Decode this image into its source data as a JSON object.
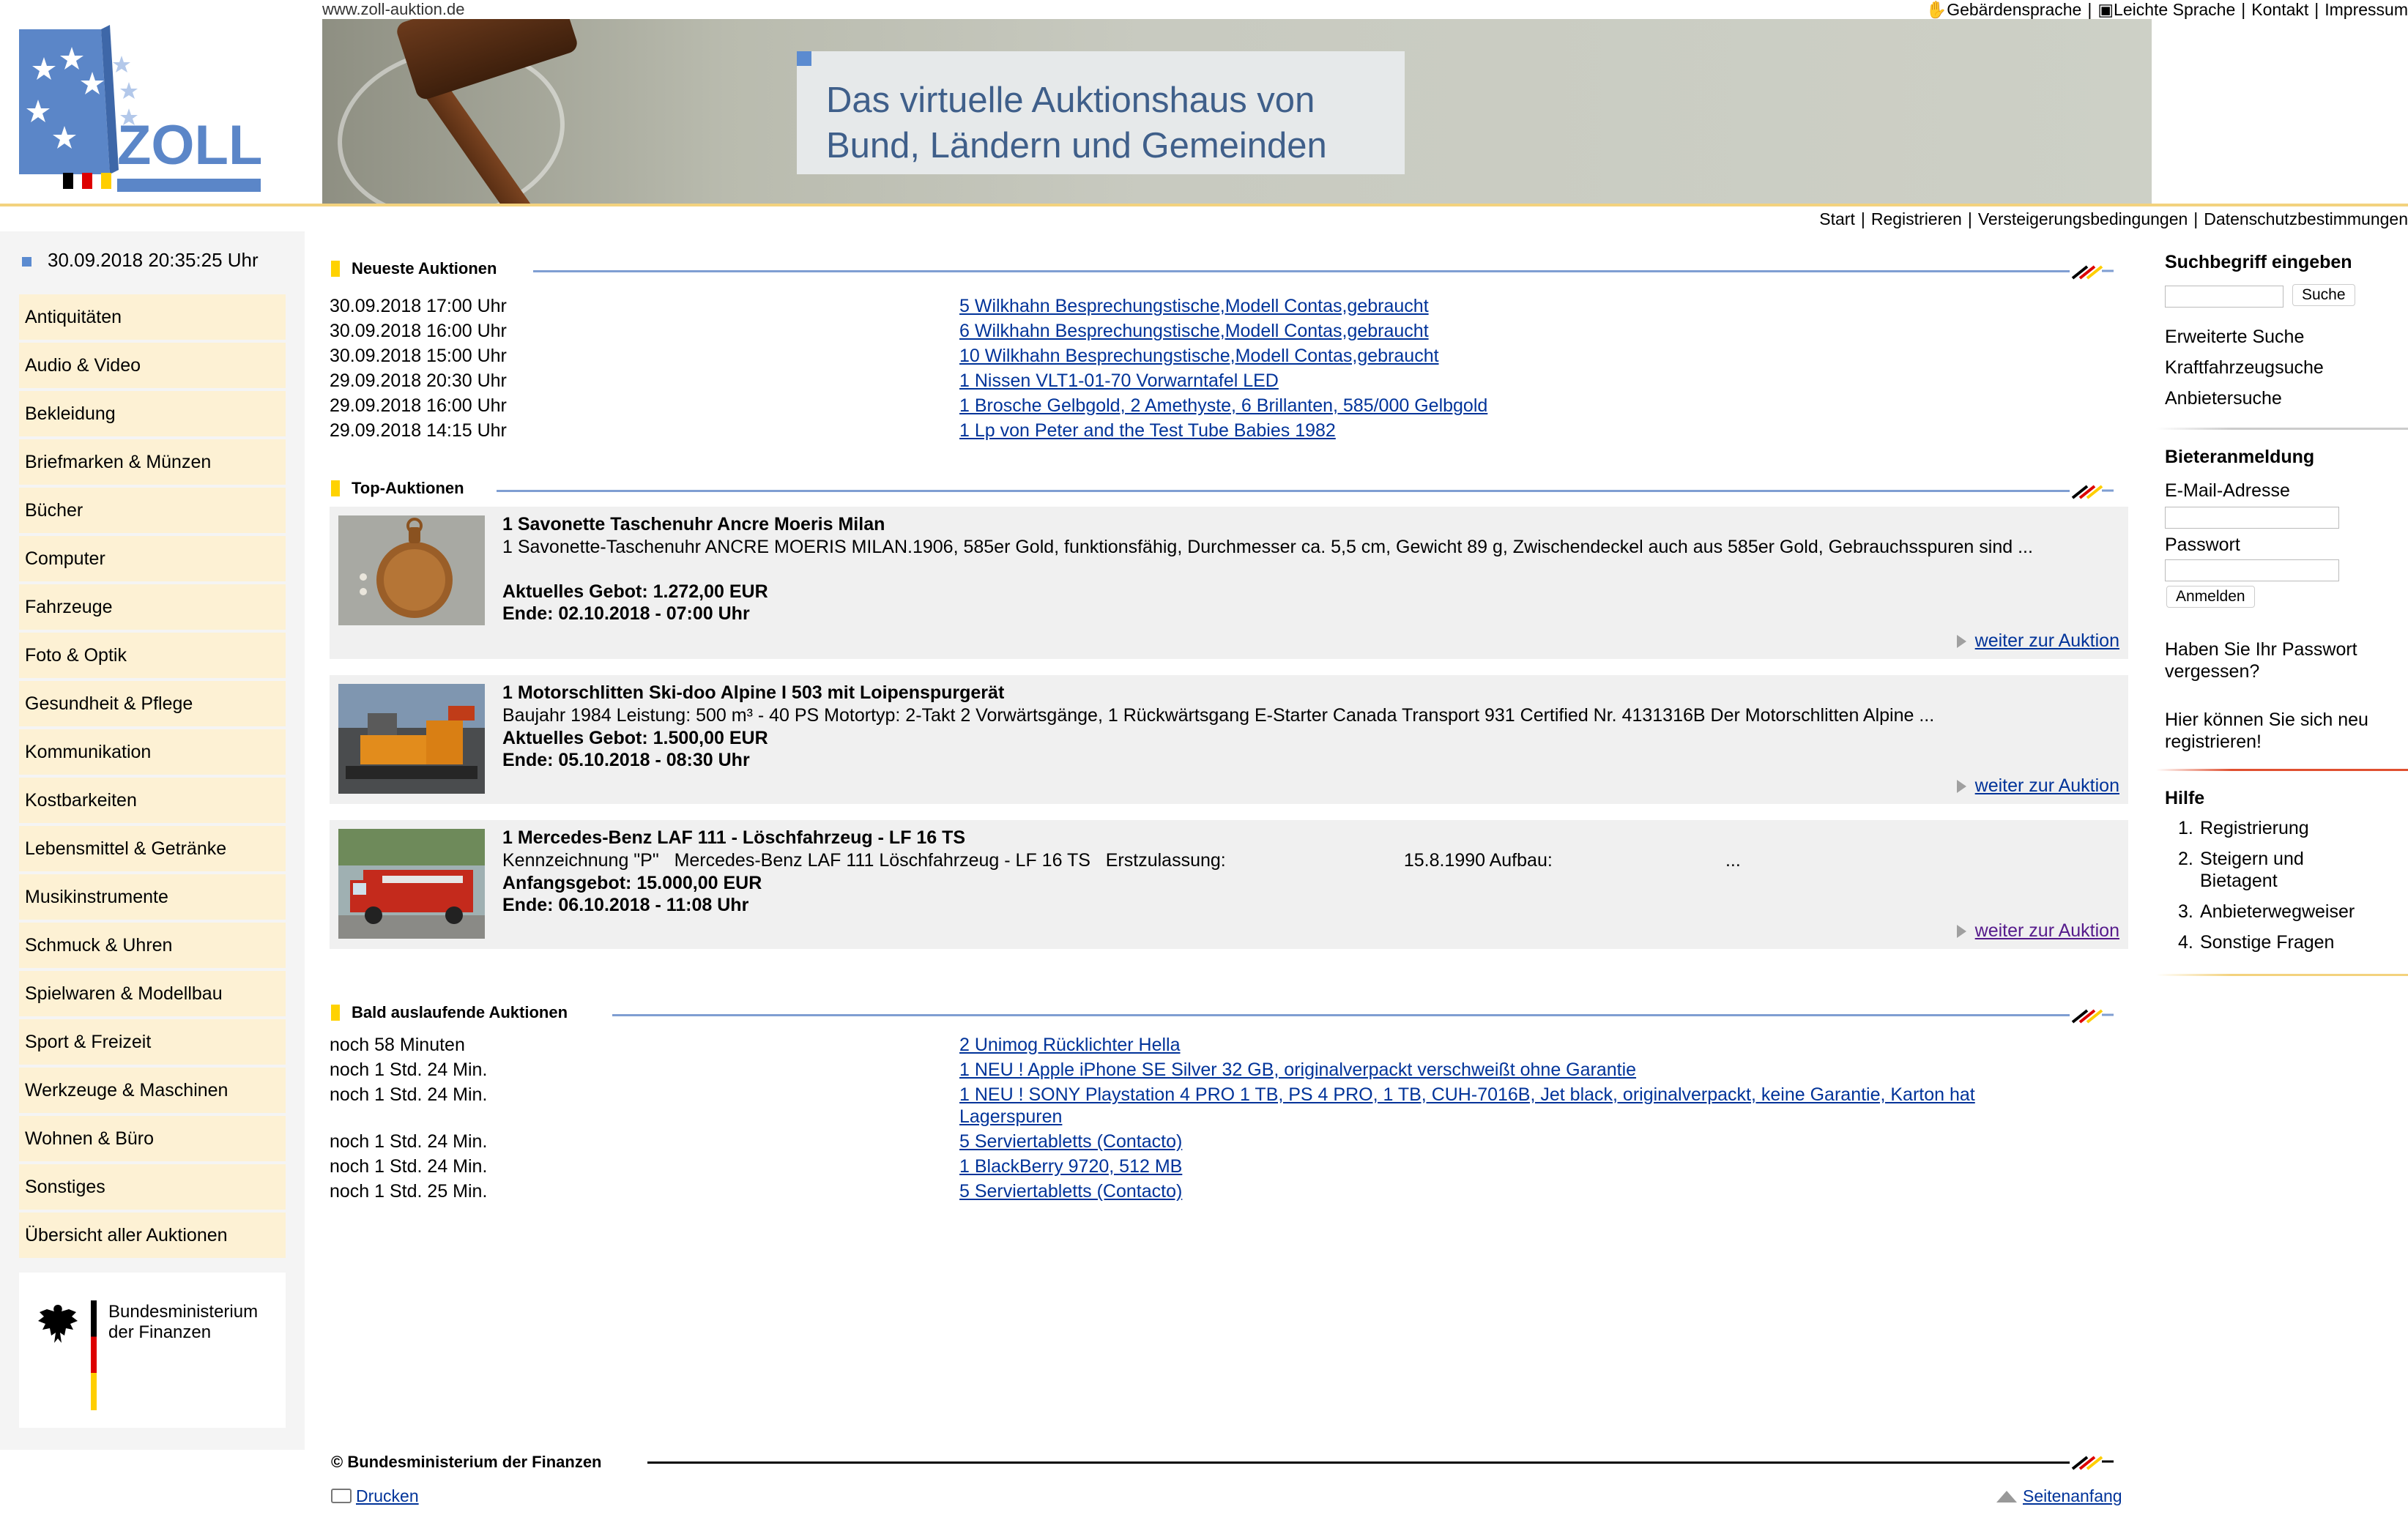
{
  "header": {
    "url": "www.zoll-auktion.de",
    "logo_text": "ZOLL",
    "banner_line1": "Das virtuelle Auktionshaus von",
    "banner_line2": "Bund, Ländern und Gemeinden",
    "topnav": [
      "Gebärdensprache",
      "Leichte Sprache",
      "Kontakt",
      "Impressum"
    ],
    "subnav": [
      "Start",
      "Registrieren",
      "Versteigerungsbedingungen",
      "Datenschutzbestimmungen"
    ]
  },
  "left": {
    "datetime": "30.09.2018 20:35:25 Uhr",
    "categories": [
      "Antiquitäten",
      "Audio & Video",
      "Bekleidung",
      "Briefmarken & Münzen",
      "Bücher",
      "Computer",
      "Fahrzeuge",
      "Foto & Optik",
      "Gesundheit & Pflege",
      "Kommunikation",
      "Kostbarkeiten",
      "Lebensmittel & Getränke",
      "Musikinstrumente",
      "Schmuck & Uhren",
      "Spielwaren & Modellbau",
      "Sport & Freizeit",
      "Werkzeuge & Maschinen",
      "Wohnen & Büro",
      "Sonstiges",
      "Übersicht aller Auktionen"
    ],
    "ministry_line1": "Bundesministerium",
    "ministry_line2": "der Finanzen"
  },
  "newest": {
    "heading": "Neueste Auktionen",
    "rows": [
      {
        "time": "30.09.2018 17:00 Uhr",
        "title": "5 Wilkhahn Besprechungstische,Modell Contas,gebraucht"
      },
      {
        "time": "30.09.2018 16:00 Uhr",
        "title": "6 Wilkhahn Besprechungstische,Modell Contas,gebraucht"
      },
      {
        "time": "30.09.2018 15:00 Uhr",
        "title": "10 Wilkhahn Besprechungstische,Modell Contas,gebraucht"
      },
      {
        "time": "29.09.2018 20:30 Uhr",
        "title": "1 Nissen VLT1-01-70 Vorwarntafel LED"
      },
      {
        "time": "29.09.2018 16:00 Uhr",
        "title": "1 Brosche Gelbgold, 2 Amethyste, 6 Brillanten, 585/000 Gelbgold"
      },
      {
        "time": "29.09.2018 14:15 Uhr",
        "title": "1 Lp von Peter and the Test Tube Babies 1982"
      }
    ]
  },
  "top": {
    "heading": "Top-Auktionen",
    "items": [
      {
        "title": "1 Savonette Taschenuhr Ancre Moeris Milan",
        "desc": "1 Savonette-Taschenuhr ANCRE MOERIS MILAN.1906, 585er Gold, funktionsfähig, Durchmesser ca. 5,5 cm, Gewicht 89 g, Zwischendeckel auch aus 585er Gold, Gebrauchsspuren sind ...",
        "bid": "Aktuelles Gebot: 1.272,00 EUR",
        "end": "Ende: 02.10.2018 - 07:00 Uhr",
        "more": "weiter zur Auktion"
      },
      {
        "title": "1 Motorschlitten Ski-doo Alpine I 503 mit Loipenspurgerät",
        "desc": "Baujahr 1984 Leistung: 500 m³ - 40 PS Motortyp: 2-Takt 2 Vorwärtsgänge, 1 Rückwärtsgang E-Starter Canada Transport 931 Certified Nr. 4131316B   Der Motorschlitten Alpine ...",
        "bid": "Aktuelles Gebot: 1.500,00 EUR",
        "end": "Ende: 05.10.2018 - 08:30 Uhr",
        "more": "weiter zur Auktion"
      },
      {
        "title": "1 Mercedes-Benz LAF 111 - Löschfahrzeug - LF 16 TS",
        "desc": "Kennzeichnung \"P\"   Mercedes-Benz LAF 111 Löschfahrzeug - LF 16 TS   Erstzulassung:                                   15.8.1990 Aufbau:                                  ...",
        "bid": "Anfangsgebot: 15.000,00 EUR",
        "end": "Ende: 06.10.2018 - 11:08 Uhr",
        "more": "weiter zur Auktion"
      }
    ]
  },
  "ending": {
    "heading": "Bald auslaufende Auktionen",
    "rows": [
      {
        "time": "noch 58 Minuten",
        "title": "2 Unimog Rücklichter Hella"
      },
      {
        "time": "noch 1 Std. 24 Min.",
        "title": "1 NEU ! Apple iPhone SE Silver 32 GB, originalverpackt verschweißt ohne Garantie"
      },
      {
        "time": "noch 1 Std. 24 Min.",
        "title": "1 NEU ! SONY Playstation 4 PRO 1 TB, PS 4 PRO, 1 TB, CUH-7016B, Jet black, originalverpackt, keine Garantie, Karton hat",
        "title2": "Lagerspuren"
      },
      {
        "time": "noch 1 Std. 24 Min.",
        "title": "5 Serviertabletts (Contacto)"
      },
      {
        "time": "noch 1 Std. 24 Min.",
        "title": "1 BlackBerry 9720, 512 MB"
      },
      {
        "time": "noch 1 Std. 25 Min.",
        "title": "5 Serviertabletts (Contacto)"
      }
    ]
  },
  "footer": {
    "copyright": "© Bundesministerium der Finanzen",
    "print": "Drucken",
    "top": "Seitenanfang"
  },
  "right": {
    "search_heading": "Suchbegriff eingeben",
    "search_button": "Suche",
    "search_placeholder": "",
    "search_links": [
      "Erweiterte Suche",
      "Kraftfahrzeugsuche",
      "Anbietersuche"
    ],
    "login_heading": "Bieteranmeldung",
    "email_label": "E-Mail-Adresse",
    "password_label": "Passwort",
    "login_button": "Anmelden",
    "forgot": "Haben Sie Ihr Passwort vergessen?",
    "register": "Hier können Sie sich neu registrieren!",
    "help_heading": "Hilfe",
    "help_items": [
      "Registrierung",
      "Steigern und Bietagent",
      "Anbieterwegweiser",
      "Sonstige Fragen"
    ]
  },
  "colors": {
    "accent_blue": "#7f9ed2",
    "category_bg": "#fdf1d4",
    "link": "#003399",
    "section_marker": "#ffd200"
  }
}
